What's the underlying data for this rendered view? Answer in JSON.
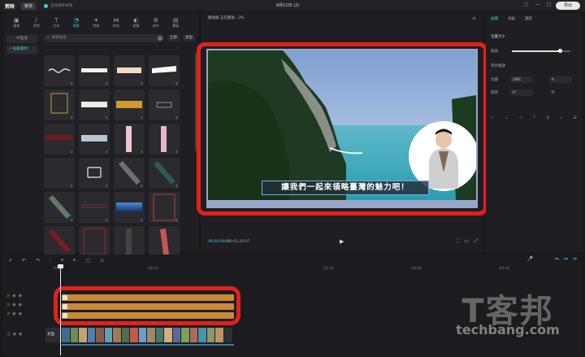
{
  "titlebar": {
    "logo": "剪映",
    "menu": "菜单",
    "status": "自动保存本地",
    "window_title": "8月11日 (2)",
    "export": "导出"
  },
  "tool_tabs": [
    {
      "label": "媒体",
      "icon": "media-icon"
    },
    {
      "label": "音频",
      "icon": "audio-icon"
    },
    {
      "label": "文本",
      "icon": "text-icon"
    },
    {
      "label": "贴纸",
      "icon": "sticker-icon",
      "active": true
    },
    {
      "label": "特效",
      "icon": "effects-icon"
    },
    {
      "label": "转场",
      "icon": "transition-icon"
    },
    {
      "label": "滤镜",
      "icon": "filter-icon"
    },
    {
      "label": "调节",
      "icon": "adjust-icon"
    },
    {
      "label": "模板",
      "icon": "template-icon"
    }
  ],
  "left_side": {
    "ai_btn": "AI生成",
    "selected": "• 贴纸素材"
  },
  "search": {
    "placeholder": "搜索贴纸",
    "filter_all": "全部",
    "filter_kind": "类型"
  },
  "player": {
    "title": "播放器",
    "status": "正在播放...3%",
    "subtitle": "讓我們一起來領略臺灣的魅力吧！",
    "time_current": "00:00:00:01",
    "time_total": "00:01:20:07"
  },
  "right_panel": {
    "tabs": [
      "画面",
      "动画",
      "跟踪"
    ],
    "scale_section": "位置大小",
    "scale_label": "缩放",
    "scale_value": 0.82,
    "uniform_label": "等比缩放",
    "pos_label": "位置",
    "pos_x": "2081",
    "pos_y": "0",
    "rot_label": "旋转",
    "rot_value": "0°"
  },
  "timeline": {
    "ruler": [
      "00:00",
      "|00:30",
      "|01:30",
      "|02:00",
      "|02:30"
    ],
    "video_label": "封面"
  },
  "watermark": {
    "big": "T客邦",
    "small": "techbang.com"
  }
}
